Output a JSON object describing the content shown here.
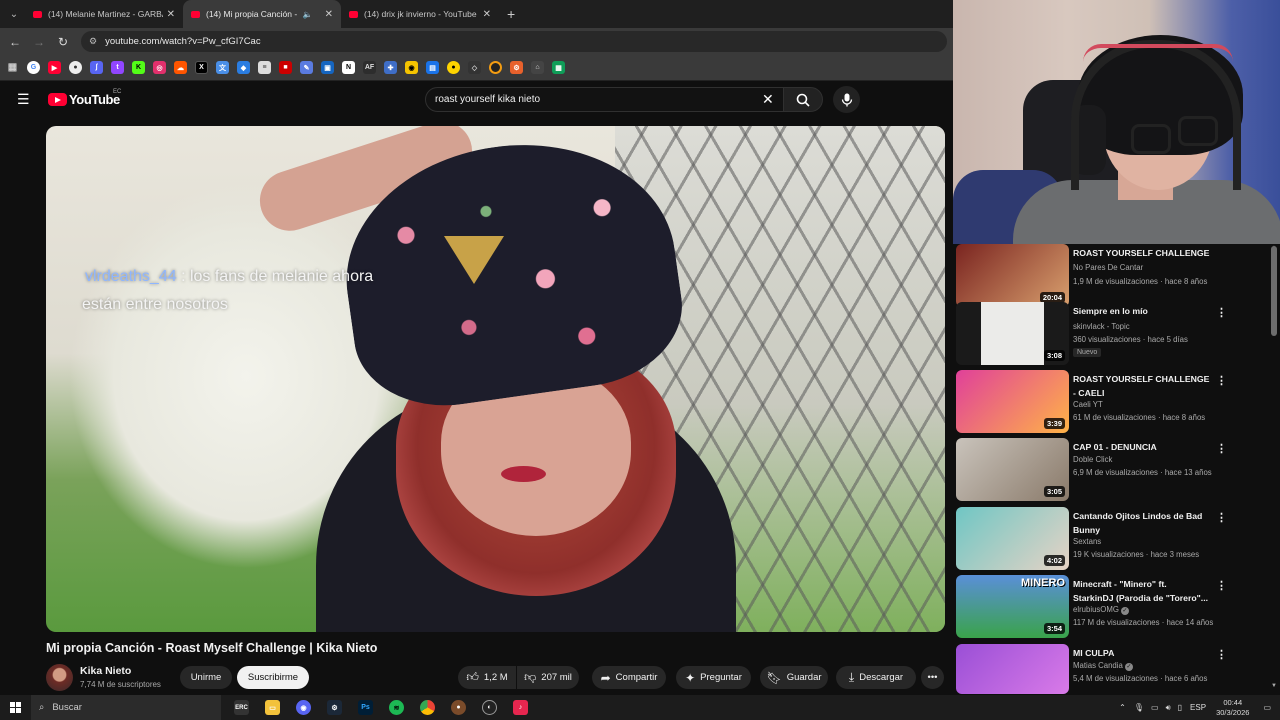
{
  "browser": {
    "tabs": [
      {
        "title": "(14) Melanie Martinez - GARBA",
        "active": false,
        "muted": false
      },
      {
        "title": "(14) Mi propia Canción - Ro",
        "active": true,
        "muted": true
      },
      {
        "title": "(14) drix jk invierno - YouTube",
        "active": false,
        "muted": false
      }
    ],
    "url": "youtube.com/watch?v=Pw_cfGI7Cac"
  },
  "youtube": {
    "logo_text": "YouTube",
    "country_code": "EC",
    "search_query": "roast yourself kika nieto"
  },
  "video": {
    "chat_user": "vlrdeaths_44",
    "chat_text_line1": " : los fans de melanie ahora",
    "chat_text_line2": "están entre nosotros",
    "title": "Mi propia Canción - Roast Myself Challenge | Kika Nieto",
    "channel_name": "Kika Nieto",
    "subscribers": "7,74 M de suscriptores",
    "join_label": "Unirme",
    "subscribe_label": "Suscribirme",
    "likes": "1,2 M",
    "dislikes": "207 mil",
    "share_label": "Compartir",
    "ask_label": "Preguntar",
    "save_label": "Guardar",
    "download_label": "Descargar"
  },
  "recommendations": [
    {
      "title_l1": "ROAST YOURSELF CHALLENGE",
      "title_l2": "",
      "channel": "No Pares De Cantar",
      "meta": "1,9 M de visualizaciones · hace 8 años",
      "duration": "20:04",
      "verified": false,
      "badge": "",
      "thumb_colors": [
        "#7a2420",
        "#d9a06e"
      ]
    },
    {
      "title_l1": "Siempre en lo mío",
      "title_l2": "",
      "channel": "skinvlack - Topic",
      "meta": "360 visualizaciones · hace 5 días",
      "duration": "3:08",
      "verified": false,
      "badge": "Nuevo",
      "thumb_colors": [
        "#e8e8e6",
        "#d0d0ce"
      ]
    },
    {
      "title_l1": "ROAST YOURSELF CHALLENGE",
      "title_l2": "- CAELI",
      "channel": "Caeli YT",
      "meta": "61 M de visualizaciones · hace 8 años",
      "duration": "3:39",
      "verified": false,
      "badge": "",
      "thumb_colors": [
        "#e0409a",
        "#ffb347"
      ]
    },
    {
      "title_l1": "CAP 01 - DENUNCIA",
      "title_l2": "",
      "channel": "Doble Click",
      "meta": "6,9 M de visualizaciones · hace 13 años",
      "duration": "3:05",
      "verified": false,
      "badge": "",
      "thumb_colors": [
        "#c9c3bb",
        "#8a7a6a"
      ]
    },
    {
      "title_l1": "Cantando Ojitos Lindos de Bad",
      "title_l2": "Bunny",
      "channel": "Sextans",
      "meta": "19 K visualizaciones · hace 3 meses",
      "duration": "4:02",
      "verified": false,
      "badge": "",
      "thumb_colors": [
        "#6fc6c4",
        "#e6d3c5"
      ]
    },
    {
      "title_l1": "Minecraft - \"Minero\" ft.",
      "title_l2": "StarkinDJ (Parodia de \"Torero\"...",
      "channel": "elrubiusOMG",
      "meta": "117 M de visualizaciones · hace 14 años",
      "duration": "3:54",
      "verified": true,
      "badge": "",
      "thumb_colors": [
        "#3aa34a",
        "#5a8fd8"
      ],
      "thumb_text": "MINERO"
    },
    {
      "title_l1": "MI CULPA",
      "title_l2": "",
      "channel": "Matias Candia",
      "meta": "5,4 M de visualizaciones · hace 6 años",
      "duration": "",
      "verified": true,
      "badge": "",
      "thumb_colors": [
        "#9a4fd6",
        "#d97ae8"
      ]
    }
  ],
  "taskbar": {
    "search_placeholder": "Buscar",
    "language": "ESP",
    "time": "00:44",
    "date": "30/3/2026"
  }
}
